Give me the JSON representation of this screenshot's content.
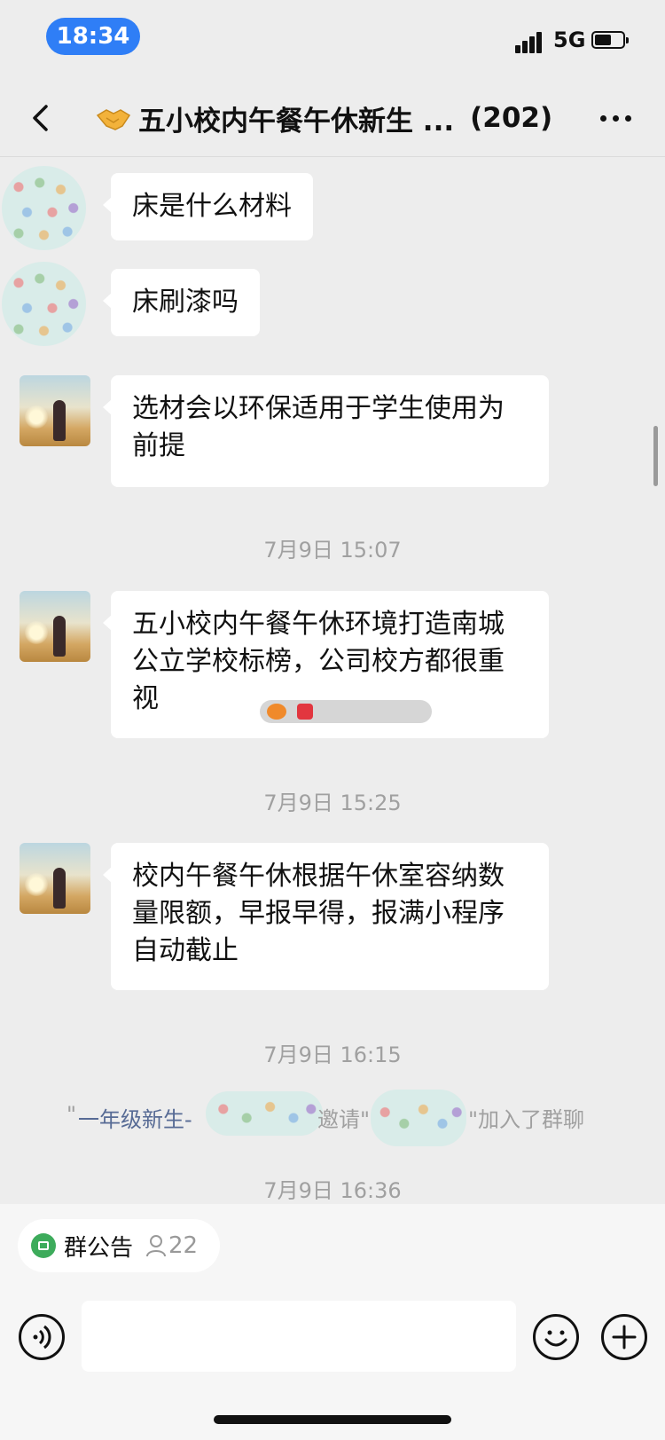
{
  "status_bar": {
    "time": "18:34",
    "network": "5G"
  },
  "header": {
    "title": "五小校内午餐午休新生 ...",
    "member_count": "(202)"
  },
  "messages": [
    {
      "text": "床是什么材料"
    },
    {
      "text": "床刷漆吗"
    },
    {
      "text": "选材会以环保适用于学生使用为前提"
    },
    {
      "text": "五小校内午餐午休环境打造南城公立学校标榜，公司校方都很重视"
    },
    {
      "text": "校内午餐午休根据午休室容纳数量限额，早报早得，报满小程序自动截止"
    }
  ],
  "timestamps": [
    "7月9日 15:07",
    "7月9日 15:25",
    "7月9日 16:15",
    "7月9日 16:36"
  ],
  "system_message": {
    "quote_open": "\"",
    "inviter": "一年级新生-",
    "invite": "邀请\"",
    "quote_close": "\"加入了群聊"
  },
  "notice_bar": {
    "label": "群公告",
    "count": "22"
  },
  "input": {
    "placeholder": ""
  },
  "colors": {
    "background": "#ededed",
    "bubble": "#ffffff",
    "time_pill": "#2f7ef6",
    "link": "#576b95",
    "notice_green": "#3dab5b"
  }
}
